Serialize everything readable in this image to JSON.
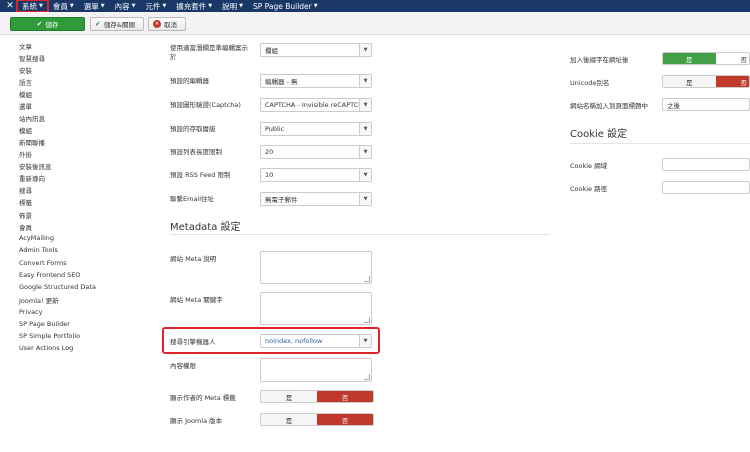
{
  "nav": {
    "items": [
      {
        "label": "系統",
        "active": true
      },
      {
        "label": "會員"
      },
      {
        "label": "選單"
      },
      {
        "label": "內容"
      },
      {
        "label": "元件"
      },
      {
        "label": "擴充套件"
      },
      {
        "label": "說明"
      },
      {
        "label": "SP Page Builder"
      }
    ]
  },
  "toolbar": {
    "save_label": "儲存",
    "save_close_label": "儲存&關閉",
    "cancel_label": "取消"
  },
  "sidebar": {
    "items": [
      "文章",
      "智慧搜尋",
      "安裝",
      "語言",
      "模組",
      "選單",
      "站內訊息",
      "模組",
      "新聞聯播",
      "外掛",
      "安裝後訊息",
      "重新導向",
      "搜尋",
      "標籤",
      "佈景",
      "會員",
      "AcyMailing",
      "Admin Tools",
      "Convert Forms",
      "Easy Frontend SEO",
      "Google Structured Data",
      "Joomla! 更新",
      "Privacy",
      "SP Page Builder",
      "SP Simple Portfolio",
      "User Actions Log"
    ]
  },
  "form": {
    "rows": [
      {
        "label": "使用適當潛欄是準編輯案示",
        "label2": "於",
        "value": "欄組"
      },
      {
        "label": "預設的編輯器",
        "value": "編輯器 - 無"
      },
      {
        "label": "預設圖形驗證(Captcha)",
        "value": "CAPTCHA - Invisible reCAPTCHA"
      },
      {
        "label": "預設的存取層級",
        "value": "Public"
      },
      {
        "label": "預設列表長度限制",
        "value": "20"
      },
      {
        "label": "預設 RSS Feed 限制",
        "value": "10"
      },
      {
        "label": "聯繫Email住址",
        "value": "無電子郵件"
      }
    ],
    "metadata_title": "Metadata 設定",
    "meta_desc_label": "網站 Meta 說明",
    "meta_keywords_label": "網站 Meta 關鍵字",
    "robots_label": "搜尋引擎機器人",
    "robots_value": "noindex, nofollow",
    "content_rights_label": "內容權限",
    "show_author_label": "顯示作者的 Meta 標籤",
    "show_joomla_label": "顯示 Joomla 版本",
    "yes": "是",
    "no": "否"
  },
  "right": {
    "add_suffix_label": "加入後綴字在網址後",
    "unicode_label": "Unicode別名",
    "sitename_label": "網站名稱加入到頁面標題中",
    "sitename_value": "之後",
    "cookie_title": "Cookie 設定",
    "cookie_domain_label": "Cookie 網域",
    "cookie_path_label": "Cookie 路徑",
    "yes": "是",
    "no": "否"
  },
  "colors": {
    "nav_bg": "#1a3867",
    "save_green": "#2f9a3a",
    "no_red": "#c0392b",
    "highlight": "#e0232b"
  }
}
